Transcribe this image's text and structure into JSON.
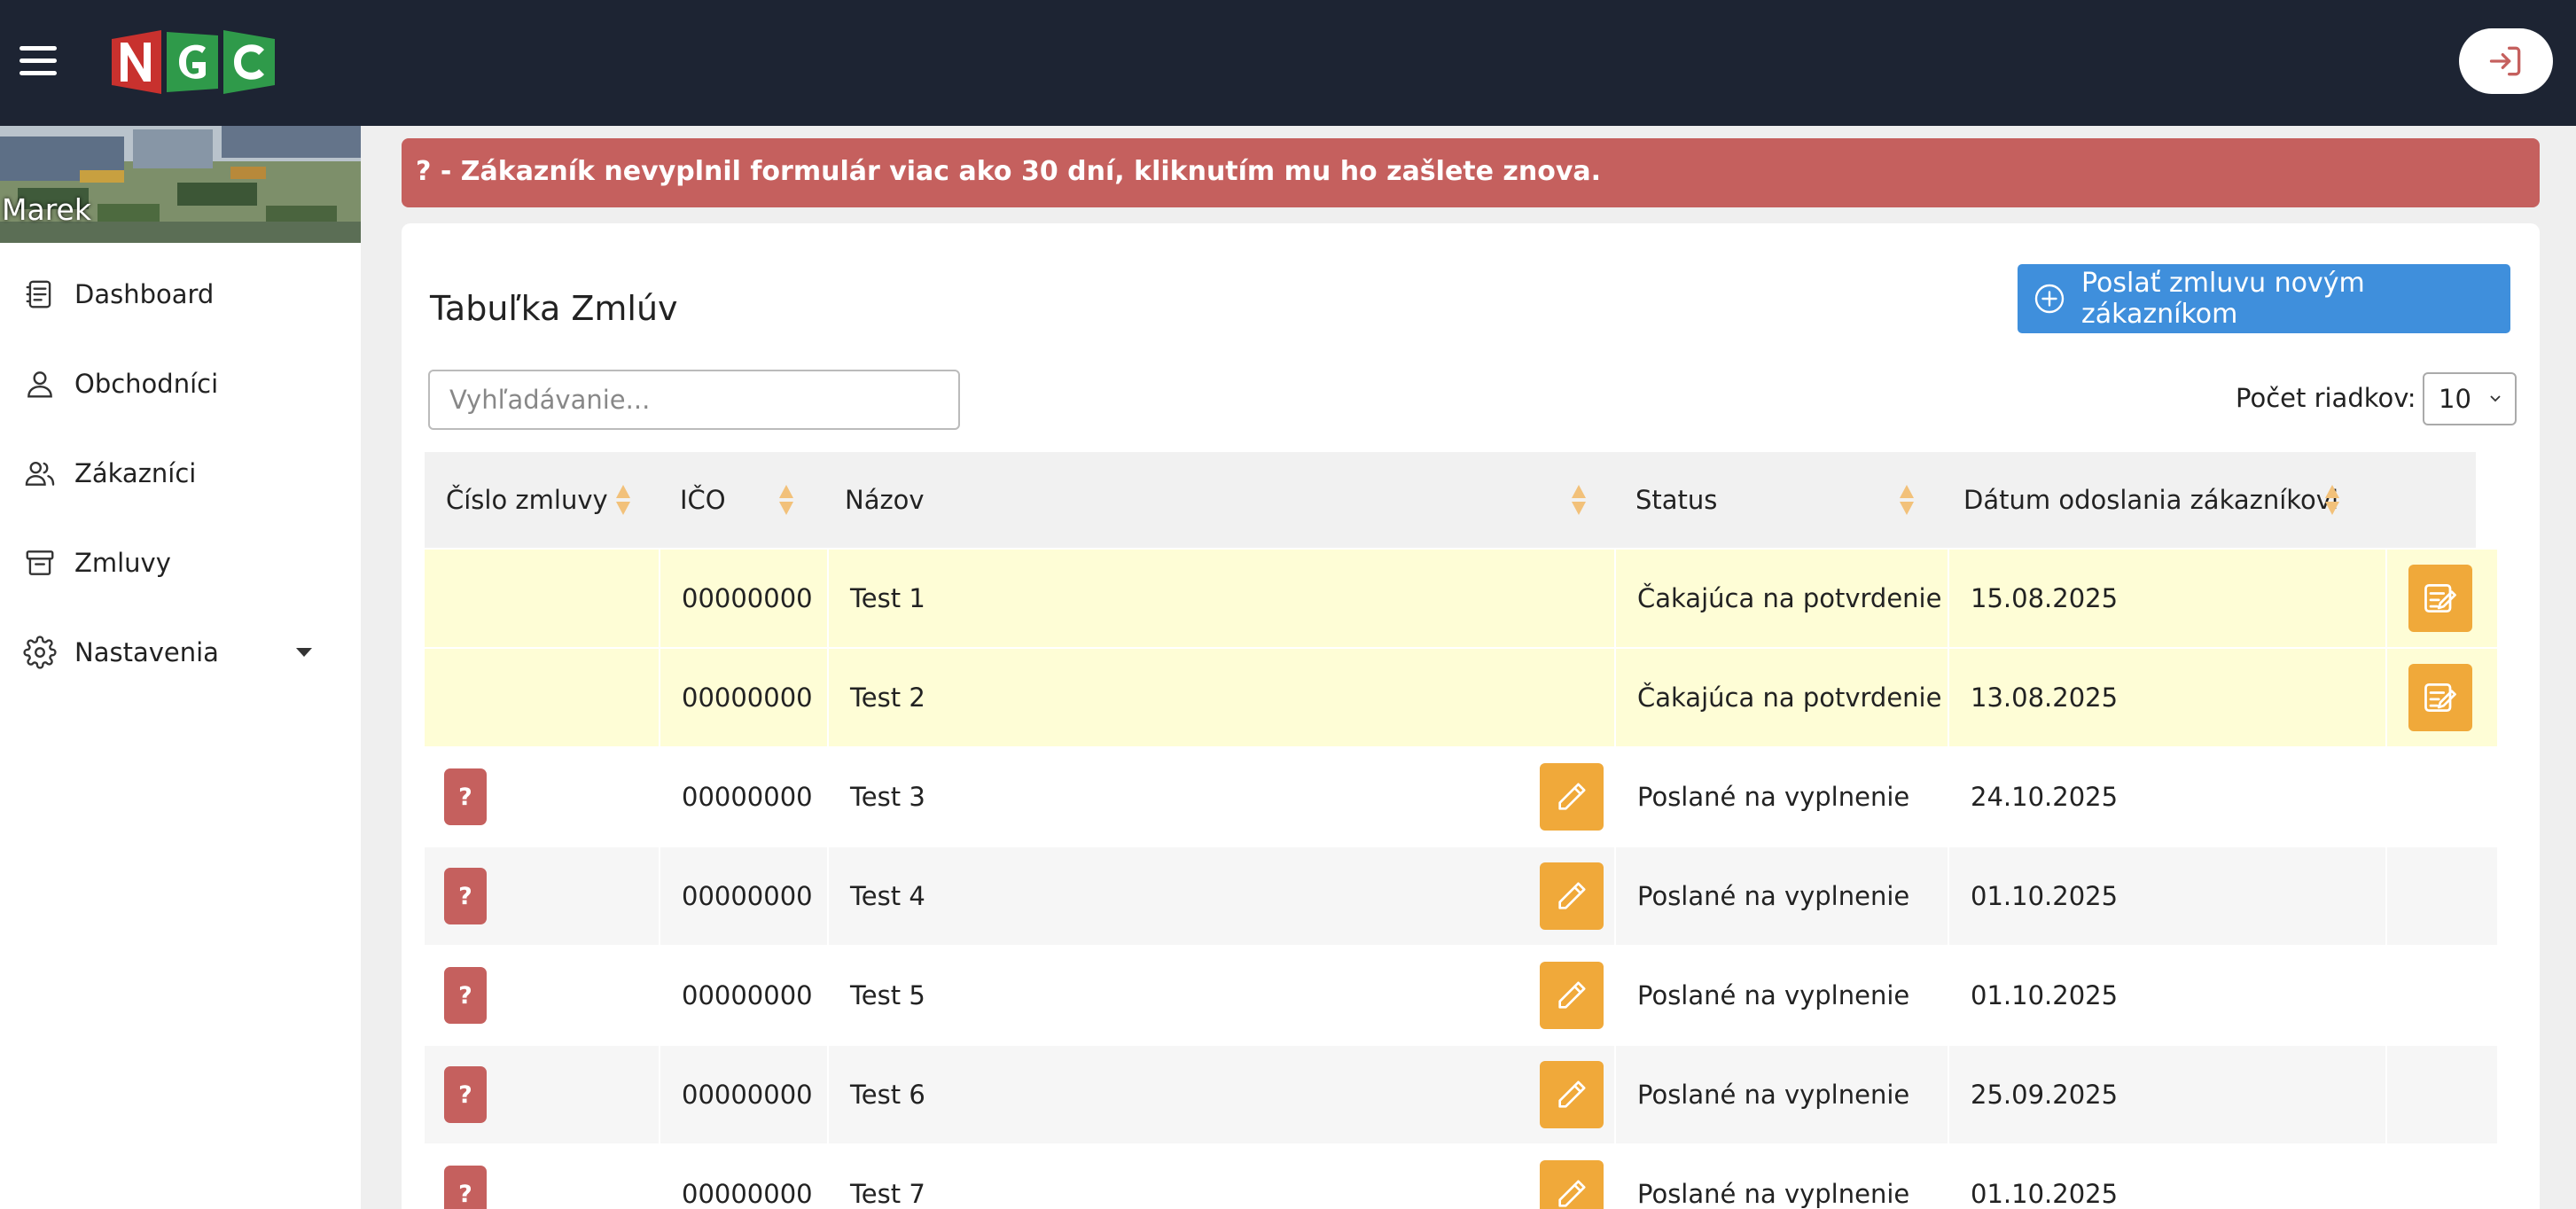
{
  "header": {
    "logo_letters": [
      "N",
      "G",
      "C"
    ],
    "colors": {
      "bar": "#1d2433",
      "logo_red": "#c8312e",
      "logo_green": "#2f9a4a"
    }
  },
  "sidebar": {
    "user": "Marek",
    "items": [
      {
        "label": "Dashboard",
        "icon": "dashboard-icon"
      },
      {
        "label": "Obchodníci",
        "icon": "user-icon"
      },
      {
        "label": "Zákazníci",
        "icon": "users-icon"
      },
      {
        "label": "Zmluvy",
        "icon": "archive-icon"
      },
      {
        "label": "Nastavenia",
        "icon": "gear-icon",
        "has_dropdown": true
      }
    ]
  },
  "alert": {
    "text": "? - Zákazník nevyplnil formulár viac ako 30 dní, kliknutím mu ho zašlete znova.",
    "color": "#c5605e"
  },
  "main": {
    "title": "Tabuľka Zmlúv",
    "new_button": "Poslať zmluvu novým zákazníkom",
    "search_placeholder": "Vyhľadávanie...",
    "rows_label": "Počet riadkov:",
    "rows_value": "10"
  },
  "table": {
    "columns": [
      "Číslo zmluvy",
      "IČO",
      "Názov",
      "Status",
      "Dátum odoslania zákazníkovi"
    ],
    "rows": [
      {
        "cislo": "",
        "ico": "00000000",
        "nazov": "Test 1",
        "status": "Čakajúca na potvrdenie",
        "datum": "15.08.2025",
        "kind": "pending"
      },
      {
        "cislo": "",
        "ico": "00000000",
        "nazov": "Test 2",
        "status": "Čakajúca na potvrdenie",
        "datum": "13.08.2025",
        "kind": "pending"
      },
      {
        "cislo": "?",
        "ico": "00000000",
        "nazov": "Test 3",
        "status": "Poslané na vyplnenie",
        "datum": "24.10.2025",
        "kind": "sent"
      },
      {
        "cislo": "?",
        "ico": "00000000",
        "nazov": "Test 4",
        "status": "Poslané na vyplnenie",
        "datum": "01.10.2025",
        "kind": "sent"
      },
      {
        "cislo": "?",
        "ico": "00000000",
        "nazov": "Test 5",
        "status": "Poslané na vyplnenie",
        "datum": "01.10.2025",
        "kind": "sent"
      },
      {
        "cislo": "?",
        "ico": "00000000",
        "nazov": "Test 6",
        "status": "Poslané na vyplnenie",
        "datum": "25.09.2025",
        "kind": "sent"
      },
      {
        "cislo": "?",
        "ico": "00000000",
        "nazov": "Test 7",
        "status": "Poslané na vyplnenie",
        "datum": "01.10.2025",
        "kind": "sent"
      }
    ],
    "colors": {
      "pending_row": "#fefdd6",
      "alt_row": "#f6f6f6",
      "question_btn": "#c5605e",
      "action_btn": "#f0a93a",
      "sort_arrow": "#f2c17a"
    }
  }
}
